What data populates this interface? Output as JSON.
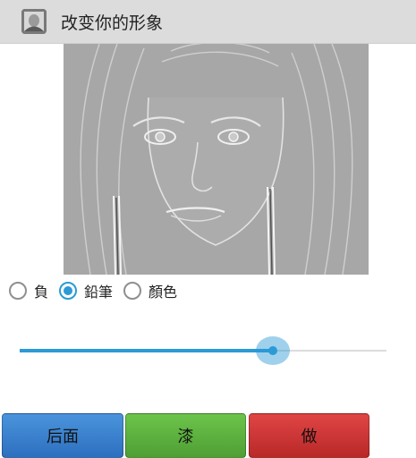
{
  "app": {
    "title": "改变你的形象",
    "icon": "app-portrait-icon"
  },
  "image": {
    "description_icon": "sketch-portrait-image"
  },
  "effects": {
    "options": [
      {
        "label": "負",
        "checked": false
      },
      {
        "label": "鉛筆",
        "checked": true
      },
      {
        "label": "顏色",
        "checked": false
      }
    ]
  },
  "slider": {
    "value_fraction": 0.69
  },
  "buttons": {
    "back": "后面",
    "paint": "漆",
    "do": "做"
  },
  "colors": {
    "accent": "#2b9ad6",
    "back_btn": "#3a82cf",
    "paint_btn": "#5fb53f",
    "do_btn": "#cf3535"
  }
}
